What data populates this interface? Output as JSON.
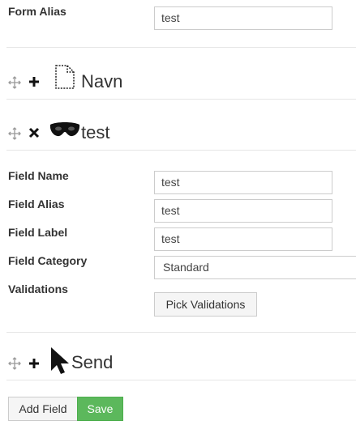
{
  "form": {
    "alias_label": "Form Alias",
    "alias_value": "test"
  },
  "fields": [
    {
      "title": "Navn",
      "toggle_icon": "plus-icon",
      "type_icon": "document-icon"
    },
    {
      "title": "test",
      "toggle_icon": "close-icon",
      "type_icon": "mask-icon",
      "editor": {
        "name_label": "Field Name",
        "name_value": "test",
        "alias_label": "Field Alias",
        "alias_value": "test",
        "label_label": "Field Label",
        "label_value": "test",
        "category_label": "Field Category",
        "category_value": "Standard",
        "validations_label": "Validations",
        "pick_validations": "Pick Validations"
      }
    },
    {
      "title": "Send",
      "toggle_icon": "plus-icon",
      "type_icon": "cursor-icon"
    }
  ],
  "footer": {
    "add_field": "Add Field",
    "save": "Save"
  },
  "colors": {
    "save_bg": "#5cb85c",
    "button_bg": "#f5f5f5",
    "border": "#cccccc"
  }
}
